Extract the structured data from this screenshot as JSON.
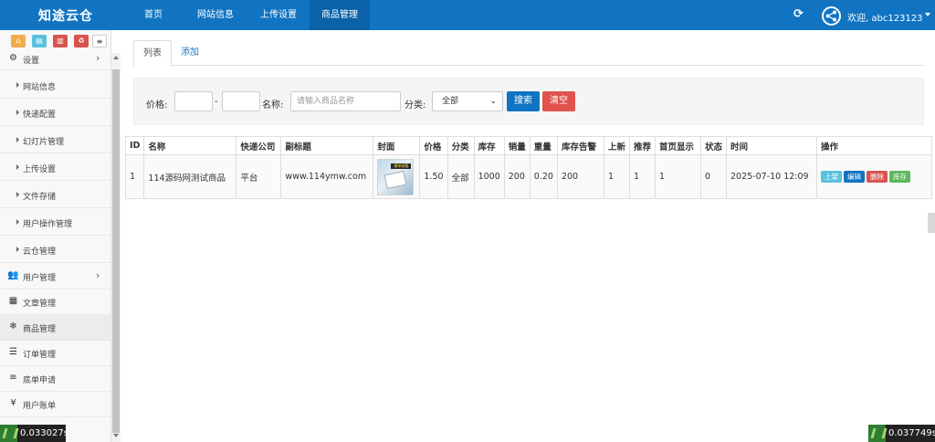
{
  "header": {
    "brand": "知途云仓",
    "nav": [
      "首页",
      "网站信息",
      "上传设置",
      "商品管理"
    ],
    "active_nav": "商品管理",
    "user_label": "欢迎, abc123123"
  },
  "sidebar": {
    "shortcuts": [
      {
        "icon": "home-icon",
        "color": "#f0ad4e"
      },
      {
        "icon": "file-icon",
        "color": "#5bc0de"
      },
      {
        "icon": "trash-icon",
        "color": "#d9534f"
      },
      {
        "icon": "recycle-icon",
        "color": "#d9534f"
      },
      {
        "icon": "list-icon",
        "color": "#ffffff"
      }
    ],
    "section": "设置",
    "sub_items": [
      "网站信息",
      "快递配置",
      "幻灯片管理",
      "上传设置",
      "文件存储",
      "用户操作管理",
      "云仓管理"
    ],
    "items": [
      {
        "label": "用户管理",
        "icon": "users-icon",
        "has_children": true
      },
      {
        "label": "文章管理",
        "icon": "newspaper-icon",
        "has_children": false
      },
      {
        "label": "商品管理",
        "icon": "snowflake-icon",
        "has_children": false
      },
      {
        "label": "订单管理",
        "icon": "server-icon",
        "has_children": false
      },
      {
        "label": "底单申请",
        "icon": "bars-icon",
        "has_children": false
      },
      {
        "label": "用户账单",
        "icon": "yen-icon",
        "has_children": false
      }
    ]
  },
  "tabs": [
    {
      "label": "列表",
      "active": true
    },
    {
      "label": "添加",
      "active": false
    }
  ],
  "filter": {
    "price_label": "价格:",
    "dash": "-",
    "name_label": "名称:",
    "name_placeholder": "请输入商品名称",
    "category_label": "分类:",
    "category_value": "全部",
    "search_label": "搜索",
    "clear_label": "清空"
  },
  "table": {
    "columns": [
      "ID",
      "名称",
      "快递公司",
      "副标题",
      "封面",
      "价格",
      "分类",
      "库存",
      "销量",
      "重量",
      "库存告警",
      "上新",
      "推荐",
      "首页显示",
      "状态",
      "时间",
      "操作"
    ],
    "rows": [
      {
        "id": "1",
        "name": "114源码网测试商品",
        "courier": "平台",
        "subtitle": "www.114ymw.com",
        "price": "1.50",
        "category": "全部",
        "stock": "1000",
        "sales": "200",
        "weight": "0.20",
        "stock_alert": "200",
        "is_new": "1",
        "recommend": "1",
        "home_show": "1",
        "status": "0",
        "time": "2025-07-10 12:09",
        "cover_tag": "爆单秘籍",
        "actions": [
          "上架",
          "编辑",
          "删除",
          "库存"
        ]
      }
    ]
  },
  "timings": {
    "left": "0.033027s",
    "right": "0.037749s"
  }
}
